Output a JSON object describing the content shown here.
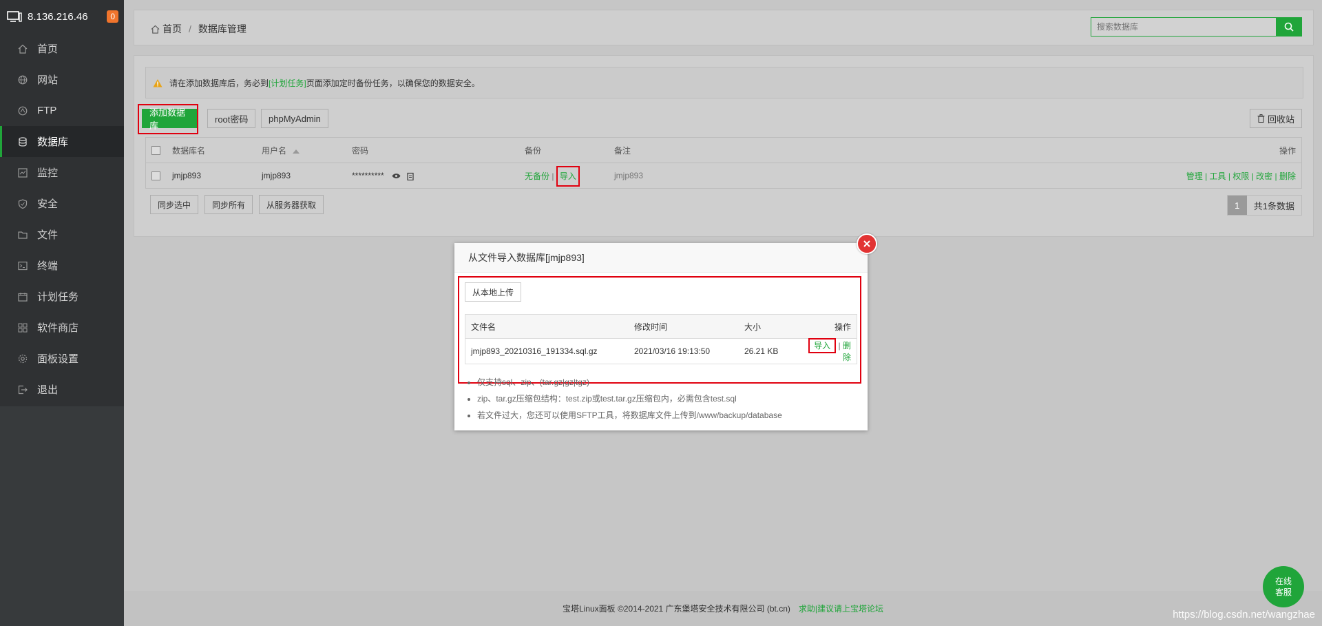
{
  "sidebar": {
    "ip": "8.136.216.46",
    "badge": "0",
    "items": [
      {
        "label": "首页",
        "icon": "home-icon"
      },
      {
        "label": "网站",
        "icon": "globe-icon"
      },
      {
        "label": "FTP",
        "icon": "ftp-icon"
      },
      {
        "label": "数据库",
        "icon": "database-icon"
      },
      {
        "label": "监控",
        "icon": "monitor-icon"
      },
      {
        "label": "安全",
        "icon": "shield-icon"
      },
      {
        "label": "文件",
        "icon": "folder-icon"
      },
      {
        "label": "终端",
        "icon": "terminal-icon"
      },
      {
        "label": "计划任务",
        "icon": "calendar-icon"
      },
      {
        "label": "软件商店",
        "icon": "apps-icon"
      },
      {
        "label": "面板设置",
        "icon": "gear-icon"
      },
      {
        "label": "退出",
        "icon": "logout-icon"
      }
    ],
    "active_index": 3
  },
  "header": {
    "breadcrumb_home": "首页",
    "breadcrumb_sep": "/",
    "breadcrumb_current": "数据库管理",
    "search_placeholder": "搜索数据库"
  },
  "notice": {
    "prefix": "请在添加数据库后，务必到",
    "link": "[计划任务]",
    "suffix": "页面添加定时备份任务，以确保您的数据安全。"
  },
  "toolbar": {
    "add_db": "添加数据库",
    "root_pwd": "root密码",
    "phpmyadmin": "phpMyAdmin",
    "recycle": "回收站"
  },
  "table": {
    "headers": {
      "name": "数据库名",
      "user": "用户名",
      "password": "密码",
      "backup": "备份",
      "remark": "备注",
      "ops": "操作"
    },
    "row": {
      "name": "jmjp893",
      "user": "jmjp893",
      "password": "**********",
      "backup_none": "无备份",
      "backup_sep": "|",
      "import": "导入",
      "remark": "jmjp893",
      "ops": [
        "管理",
        "工具",
        "权限",
        "改密",
        "删除"
      ]
    }
  },
  "bottom_buttons": {
    "sync_selected": "同步选中",
    "sync_all": "同步所有",
    "from_server": "从服务器获取"
  },
  "pager": {
    "page": "1",
    "total": "共1条数据"
  },
  "modal": {
    "title": "从文件导入数据库[jmjp893]",
    "upload": "从本地上传",
    "headers": {
      "filename": "文件名",
      "mtime": "修改时间",
      "size": "大小",
      "ops": "操作"
    },
    "file": {
      "name": "jmjp893_20210316_191334.sql.gz",
      "mtime": "2021/03/16 19:13:50",
      "size": "26.21 KB",
      "import": "导入",
      "sep": "|",
      "delete": "删除"
    },
    "tips": [
      "仅支持sql、zip、(tar.gz|gz|tgz)",
      "zip、tar.gz压缩包结构：test.zip或test.tar.gz压缩包内，必需包含test.sql",
      "若文件过大，您还可以使用SFTP工具，将数据库文件上传到/www/backup/database"
    ]
  },
  "footer": {
    "copyright": "宝塔Linux面板 ©2014-2021 广东堡塔安全技术有限公司 (bt.cn)",
    "link": "求助|建议请上宝塔论坛"
  },
  "chat": {
    "line1": "在线",
    "line2": "客服"
  },
  "watermark": "https://blog.csdn.net/wangzhae",
  "colors": {
    "accent": "#20a53a",
    "highlight": "#e0000f",
    "sidebar": "#2f3133"
  }
}
